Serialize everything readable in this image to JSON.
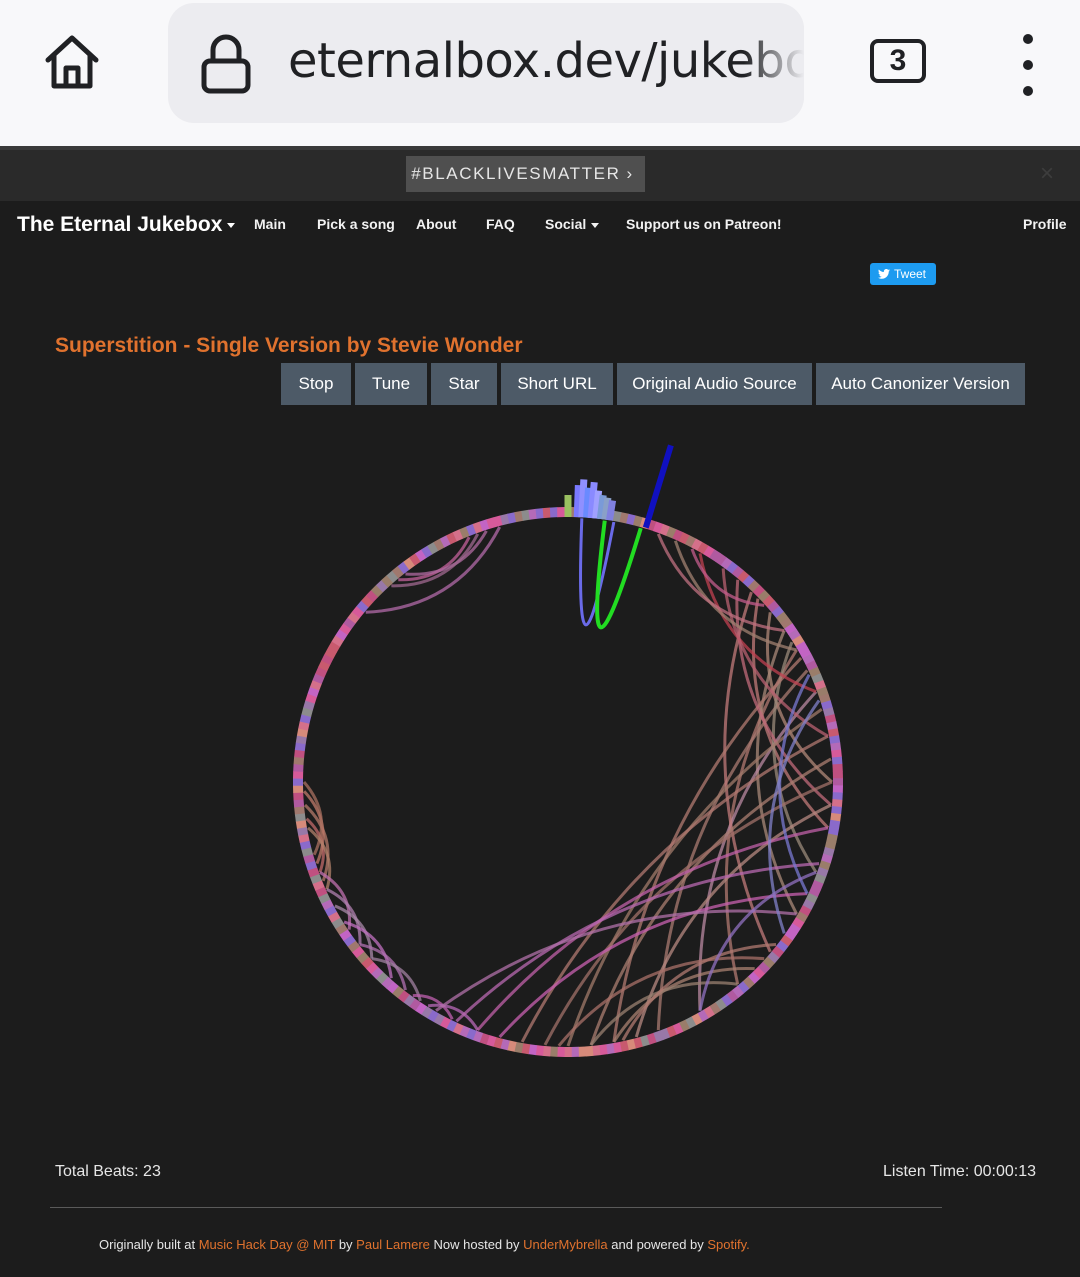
{
  "browser": {
    "url": "eternalbox.dev/jukebox",
    "tab_count": "3"
  },
  "banner": {
    "label": "#BLACKLIVESMATTER",
    "chevron": "›",
    "close": "×"
  },
  "nav": {
    "brand": "The Eternal Jukebox",
    "items": {
      "main": "Main",
      "pick": "Pick a song",
      "about": "About",
      "faq": "FAQ",
      "social": "Social",
      "patreon": "Support us on Patreon!",
      "profile": "Profile"
    }
  },
  "tweet": {
    "label": "Tweet"
  },
  "song": {
    "title": "Superstition - Single Version by Stevie Wonder"
  },
  "buttons": {
    "stop": "Stop",
    "tune": "Tune",
    "star": "Star",
    "short_url": "Short URL",
    "original_audio": "Original Audio Source",
    "auto_canonizer": "Auto Canonizer Version"
  },
  "stats": {
    "total_beats": "Total Beats: 23",
    "listen_time": "Listen Time: 00:00:13"
  },
  "footer": {
    "t1": "Originally built at ",
    "l1": "Music Hack Day @ MIT",
    "t2": " by ",
    "l2": "Paul Lamere",
    "t3": " Now hosted by ",
    "l3": "UnderMybrella",
    "t4": " and powered by ",
    "l4": "Spotify."
  },
  "colors": {
    "accent": "#e0722e",
    "button": "#4d5a67",
    "background": "#1c1c1c",
    "tweet": "#1d9bf0",
    "current_beat": "#1010c0",
    "active_jump": "#22dd22"
  },
  "icons": [
    "home-icon",
    "lock-icon",
    "tab-switcher-icon",
    "more-vert-icon",
    "twitter-bird-icon",
    "close-icon",
    "caret-down-icon"
  ]
}
